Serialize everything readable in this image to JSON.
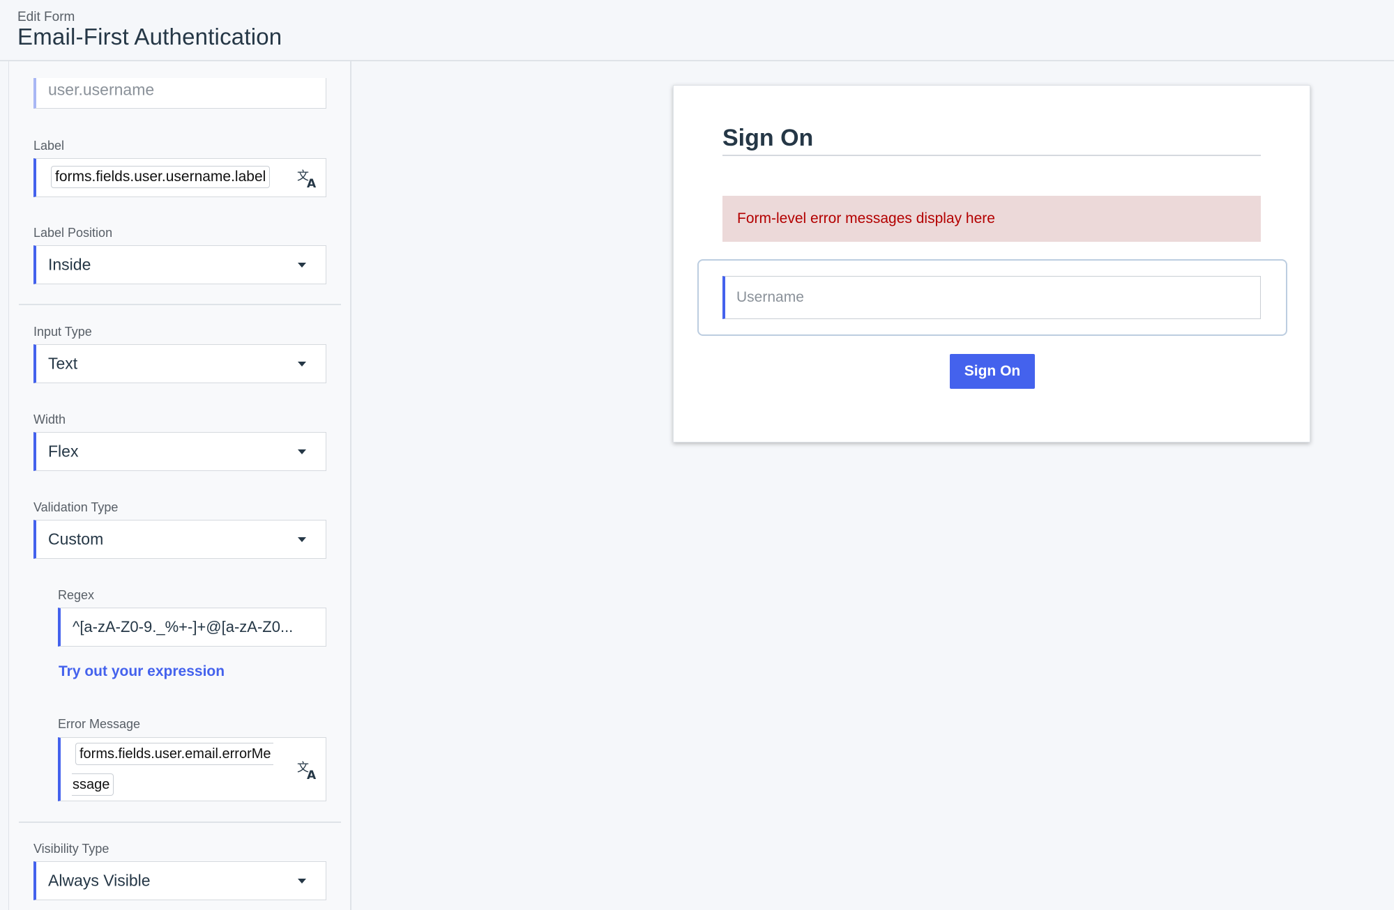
{
  "header": {
    "overline": "Edit Form",
    "title": "Email-First Authentication"
  },
  "panel": {
    "attribute_value": "user.username",
    "label_field": {
      "label": "Label",
      "value": "forms.fields.user.username.label"
    },
    "label_position": {
      "label": "Label Position",
      "value": "Inside"
    },
    "input_type": {
      "label": "Input Type",
      "value": "Text"
    },
    "width": {
      "label": "Width",
      "value": "Flex"
    },
    "validation_type": {
      "label": "Validation Type",
      "value": "Custom"
    },
    "regex": {
      "label": "Regex",
      "value": "^[a-zA-Z0-9._%+-]+@[a-zA-Z0..."
    },
    "try_link": "Try out your expression",
    "error_message": {
      "label": "Error Message",
      "value_line1": "forms.fields.user.email.errorMe",
      "value_line2": "ssage"
    },
    "visibility_type": {
      "label": "Visibility Type",
      "value": "Always Visible"
    }
  },
  "preview": {
    "heading": "Sign On",
    "alert": "Form-level error messages display here",
    "username_placeholder": "Username",
    "button_label": "Sign On"
  },
  "colors": {
    "accent": "#4462ed",
    "error_text": "#b30000",
    "error_bg": "#ecd9d9"
  },
  "icons": {
    "translate": "translate-icon",
    "dropdown": "caret-down-icon"
  }
}
